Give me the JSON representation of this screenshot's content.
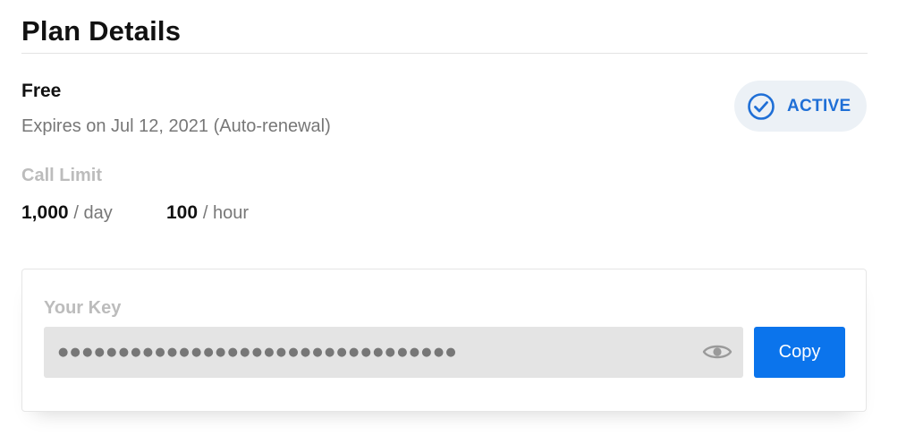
{
  "page": {
    "title": "Plan Details"
  },
  "plan": {
    "name": "Free",
    "expiry": "Expires on Jul 12, 2021 (Auto-renewal)",
    "status": {
      "label": "ACTIVE",
      "icon": "check-circle-icon",
      "color": "#1f6fd6",
      "background": "#ecf1f6"
    }
  },
  "call_limit": {
    "label": "Call Limit",
    "daily": {
      "value": "1,000",
      "unit": "/ day"
    },
    "hourly": {
      "value": "100",
      "unit": "/ hour"
    }
  },
  "api_key": {
    "label": "Your Key",
    "masked_value": "●●●●●●●●●●●●●●●●●●●●●●●●●●●●●●●●●",
    "reveal_icon": "eye-icon",
    "copy_label": "Copy",
    "copy_button_color": "#0b74ec"
  }
}
